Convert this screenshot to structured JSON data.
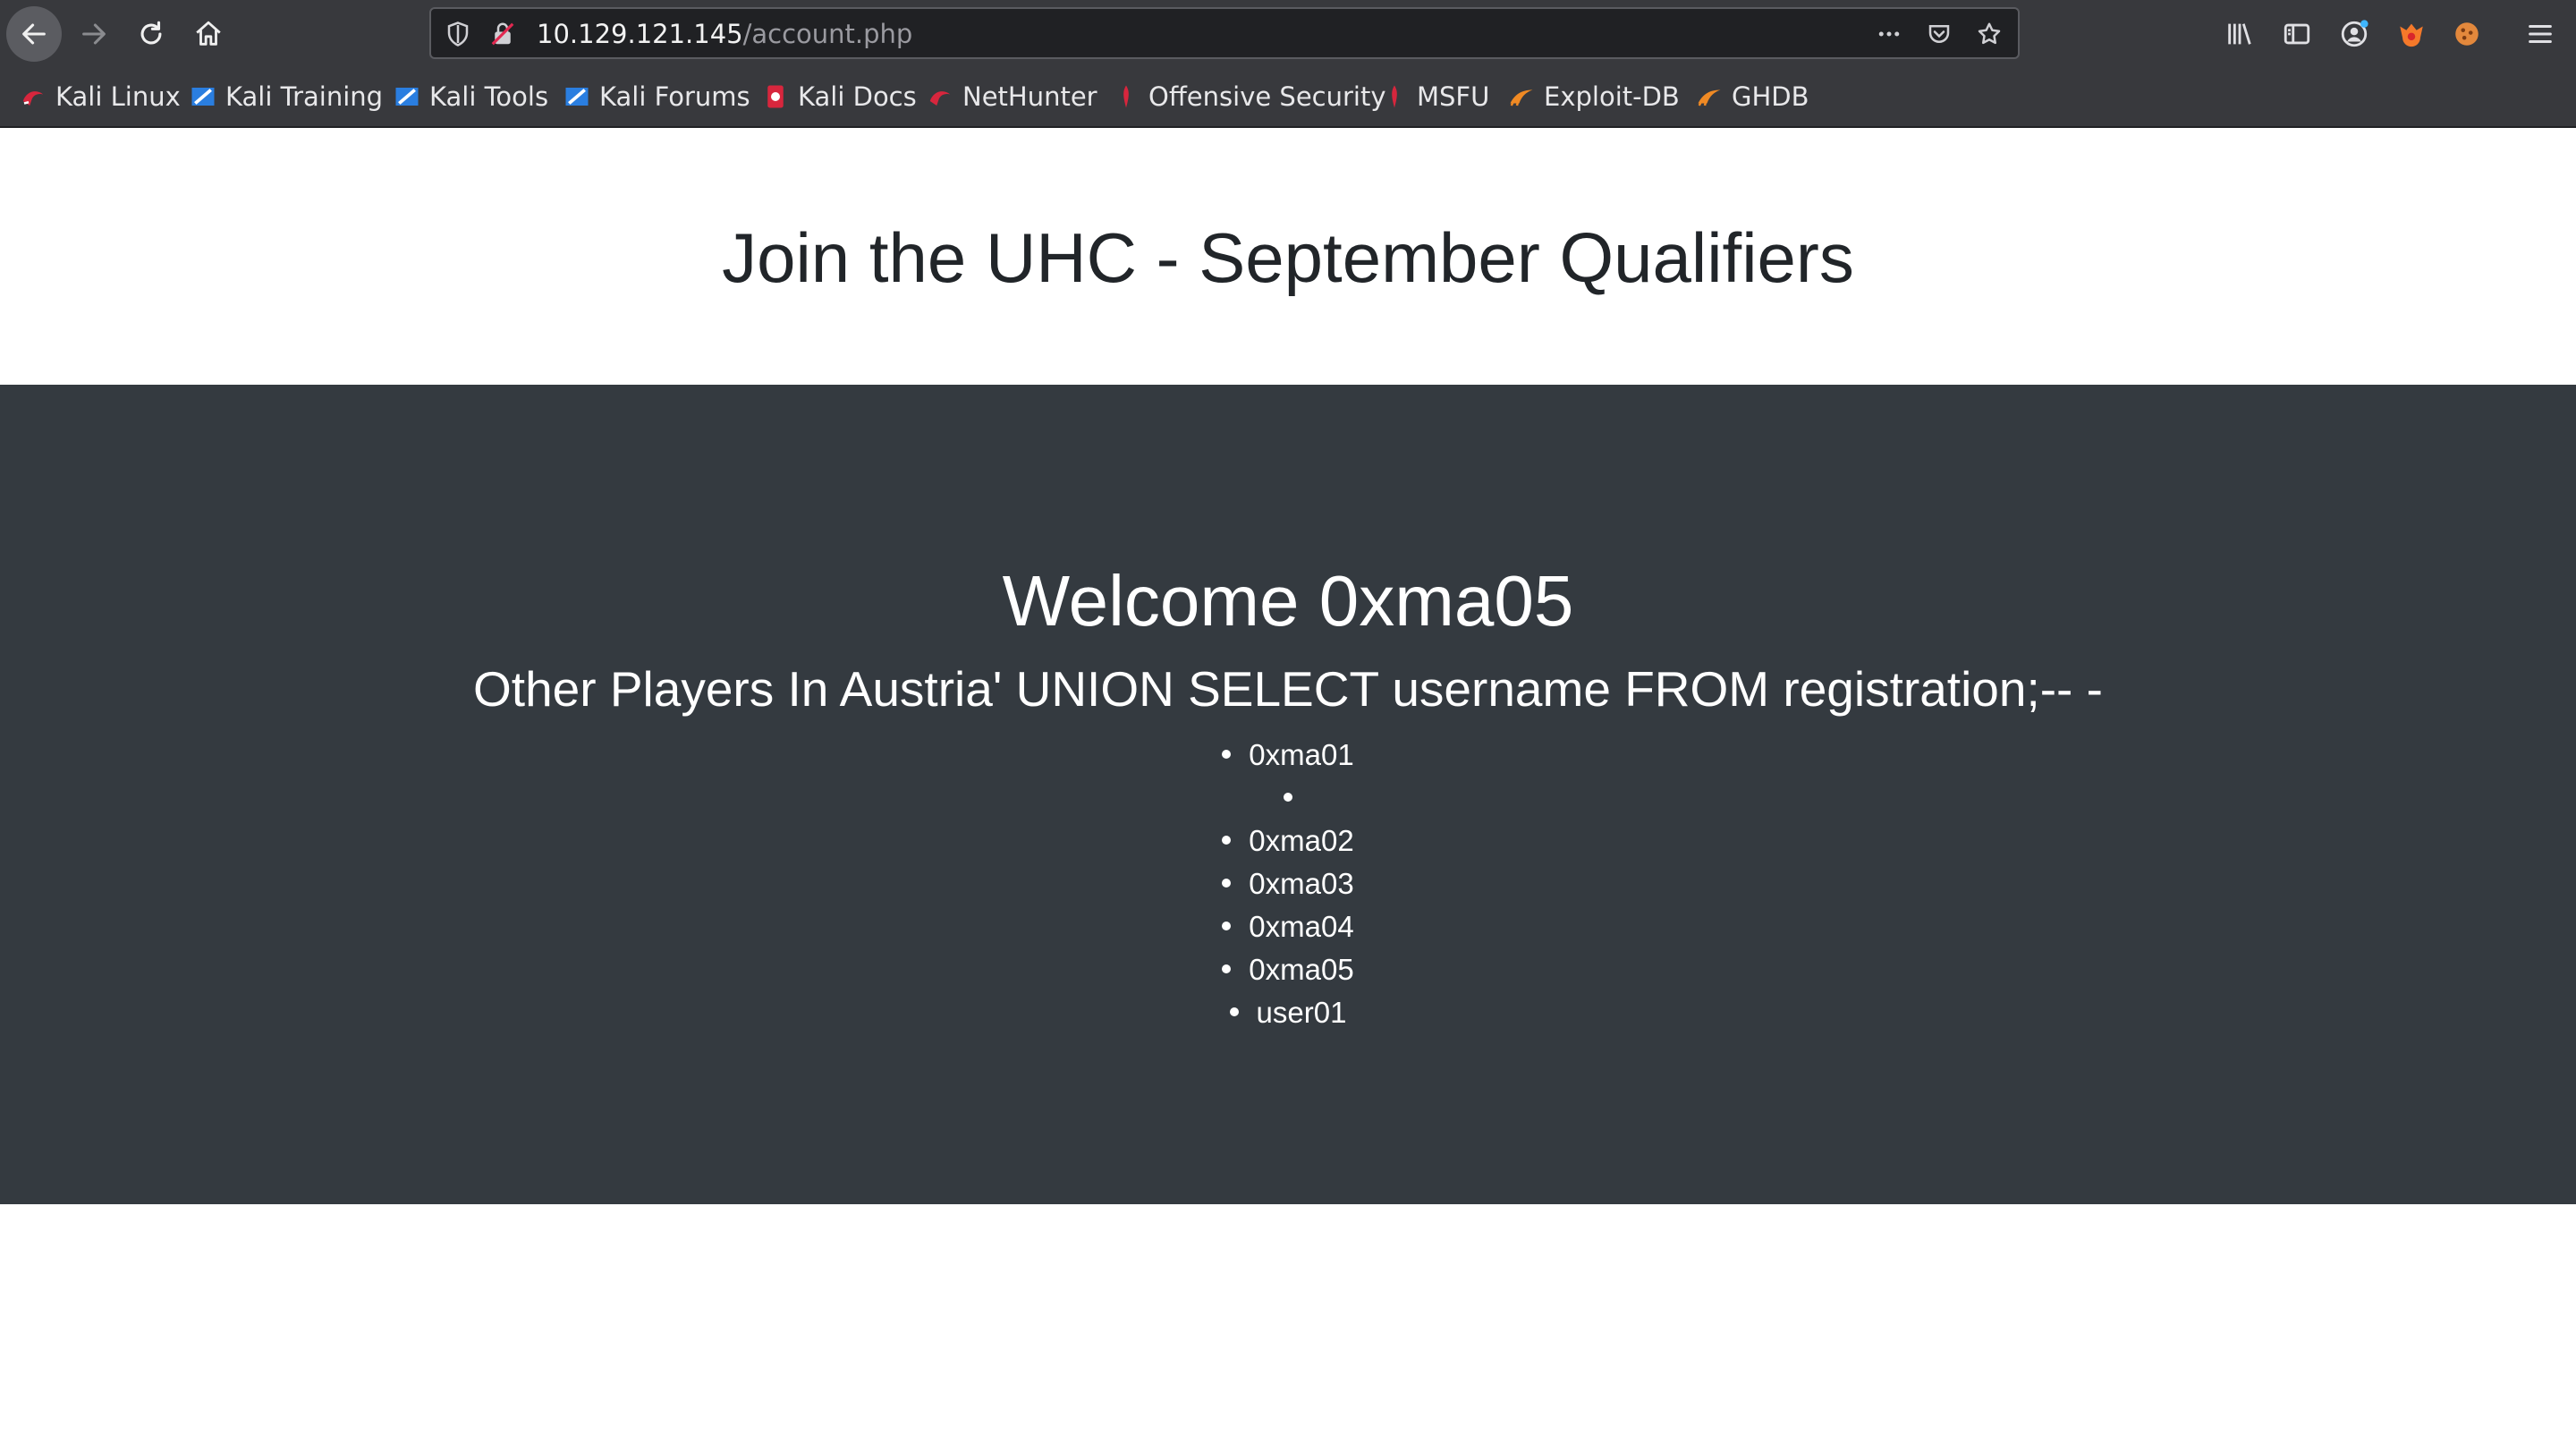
{
  "browser": {
    "url_host": "10.129.121.145",
    "url_path": "/account.php",
    "bookmarks": [
      {
        "label": "Kali Linux",
        "icon": "kali-dragon-icon"
      },
      {
        "label": "Kali Training",
        "icon": "kali-training-icon"
      },
      {
        "label": "Kali Tools",
        "icon": "kali-tools-icon"
      },
      {
        "label": "Kali Forums",
        "icon": "kali-forums-icon"
      },
      {
        "label": "Kali Docs",
        "icon": "kali-docs-icon"
      },
      {
        "label": "NetHunter",
        "icon": "nethunter-icon"
      },
      {
        "label": "Offensive Security",
        "icon": "offsec-icon"
      },
      {
        "label": "MSFU",
        "icon": "msfu-icon"
      },
      {
        "label": "Exploit-DB",
        "icon": "exploit-db-icon"
      },
      {
        "label": "GHDB",
        "icon": "ghdb-icon"
      }
    ]
  },
  "page": {
    "title": "Join the UHC - September Qualifiers",
    "welcome": "Welcome 0xma05",
    "players_heading": "Other Players In Austria' UNION SELECT username FROM registration;-- -",
    "players": [
      "0xma01",
      "",
      "0xma02",
      "0xma03",
      "0xma04",
      "0xma05",
      "user01"
    ]
  },
  "colors": {
    "chrome_bg": "#38393d",
    "urlbar_bg": "#202124",
    "hero_bg": "#343a40",
    "title_text": "#212529"
  }
}
